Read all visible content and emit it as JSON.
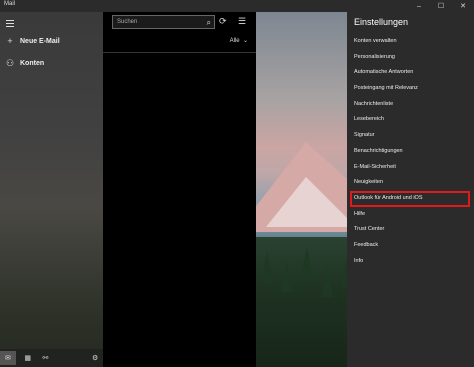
{
  "window": {
    "title": "Mail"
  },
  "nav": {
    "new_mail": "Neue E-Mail",
    "accounts": "Konten"
  },
  "list": {
    "search_placeholder": "Suchen",
    "filter": "Alle"
  },
  "settings": {
    "title": "Einstellungen",
    "items": [
      "Konten verwalten",
      "Personalisierung",
      "Automatische Antworten",
      "Posteingang mit Relevanz",
      "Nachrichtenliste",
      "Lesebereich",
      "Signatur",
      "Benachrichtigungen",
      "E-Mail-Sicherheit",
      "Neuigkeiten",
      "Outlook für Android und iOS",
      "Hilfe",
      "Trust Center",
      "Feedback",
      "Info"
    ],
    "highlighted_index": 10
  },
  "colors": {
    "highlight": "#e0191c",
    "flyout_bg": "#2b2b2b",
    "list_bg": "#000000"
  }
}
